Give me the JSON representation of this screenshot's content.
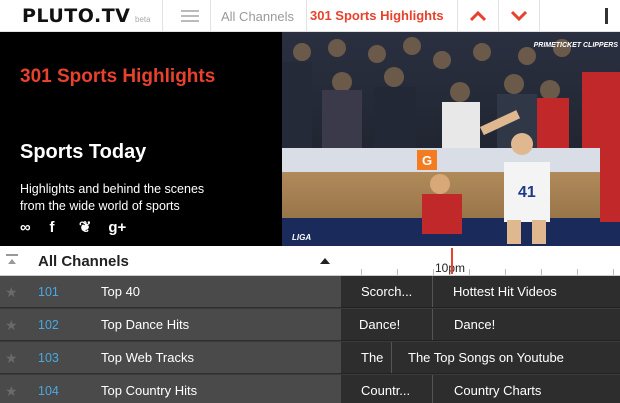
{
  "header": {
    "logo": "PLUTO.TV",
    "logo_beta": "beta",
    "breadcrumb_all": "All Channels",
    "current_channel": "301 Sports Highlights"
  },
  "hero": {
    "channel_title": "301 Sports Highlights",
    "program_title": "Sports Today",
    "description": "Highlights and behind the scenes from the wide world of sports",
    "social": [
      "link-icon",
      "facebook-icon",
      "twitter-icon",
      "google-plus-icon"
    ],
    "video_bug": "PRIMETICKET CLIPPERS",
    "video_corner": "LIGA"
  },
  "guide": {
    "header_title": "All Channels",
    "time_label": "10pm",
    "rows": [
      {
        "number": "101",
        "name": "Top 40",
        "programs": [
          "Scorch...",
          "Hottest Hit Videos"
        ]
      },
      {
        "number": "102",
        "name": "Top Dance Hits",
        "programs": [
          "Dance!",
          "Dance!"
        ]
      },
      {
        "number": "103",
        "name": "Top Web Tracks",
        "programs": [
          "The",
          "The Top Songs on Youtube"
        ]
      },
      {
        "number": "104",
        "name": "Top Country Hits",
        "programs": [
          "Countr...",
          "Country Charts"
        ]
      }
    ]
  },
  "colors": {
    "accent": "#e8412c",
    "channel_number": "#4aa8e0",
    "guide_bg": "#3b3b3b"
  }
}
